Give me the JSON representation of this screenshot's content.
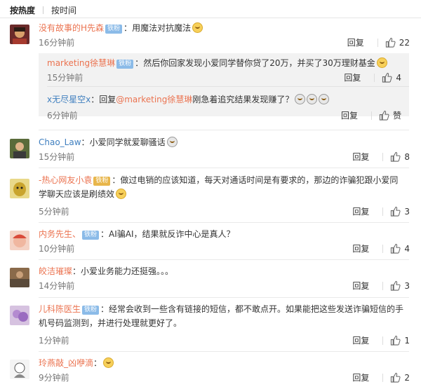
{
  "tabs": [
    "按热度",
    "按时间"
  ],
  "comments": [
    {
      "user": "没有故事的H先森",
      "badge": "铁粉",
      "text": "用魔法对抗魔法",
      "time": "16分钟前",
      "reply": "回复",
      "likes": "22",
      "subs": [
        {
          "user": "marketing徐慧琳",
          "badge": "铁粉",
          "text": "然后你回家发现小爱同学替你贷了20万，并买了30万理财基金",
          "time": "15分钟前",
          "reply": "回复",
          "likes": "4"
        },
        {
          "user": "x无尽星空x",
          "sep": "：回复",
          "mention": "@marketing徐慧琳",
          "text": "刚急着追究结果发现赚了？",
          "time": "6分钟前",
          "reply": "回复",
          "likes": "赞"
        }
      ]
    },
    {
      "user": "Chao_Law",
      "text": "小爱同学就爱聊骚话",
      "time": "15分钟前",
      "reply": "回复",
      "likes": "8"
    },
    {
      "user": "-热心网友小袁",
      "badge": "铁粉",
      "text": "做过电销的应该知道，每天对通话时间是有要求的，那边的诈骗犯跟小爱同学聊天应该是刷绩效",
      "time": "5分钟前",
      "reply": "回复",
      "likes": "3"
    },
    {
      "user": "内务先生、",
      "badge": "铁粉",
      "text": "AI骗AI，结果就反诈中心是真人？",
      "time": "10分钟前",
      "reply": "回复",
      "likes": "4"
    },
    {
      "user": "皎洁璀璨",
      "text": "小爱业务能力还挺强。。。",
      "time": "14分钟前",
      "reply": "回复",
      "likes": "3"
    },
    {
      "user": "儿科陈医生",
      "badge": "铁粉",
      "text": "经常会收到一些含有链接的短信，都不敢点开。如果能把这些发送诈骗短信的手机号码监测到，并进行处理就更好了。",
      "time": "1分钟前",
      "reply": "回复",
      "likes": "1"
    },
    {
      "user": "玲燕敲_凶咿滴",
      "text": "",
      "time": "9分钟前",
      "reply": "回复",
      "likes": "2"
    }
  ],
  "colors": {
    "username": "#eb7350",
    "mention": "#eb7350",
    "badge": "#8bbbe8",
    "time": "#777777",
    "subbg": "#f2f2f2"
  },
  "icons": [
    "thumbs-up-icon",
    "emoji-icon",
    "fan-badge"
  ]
}
